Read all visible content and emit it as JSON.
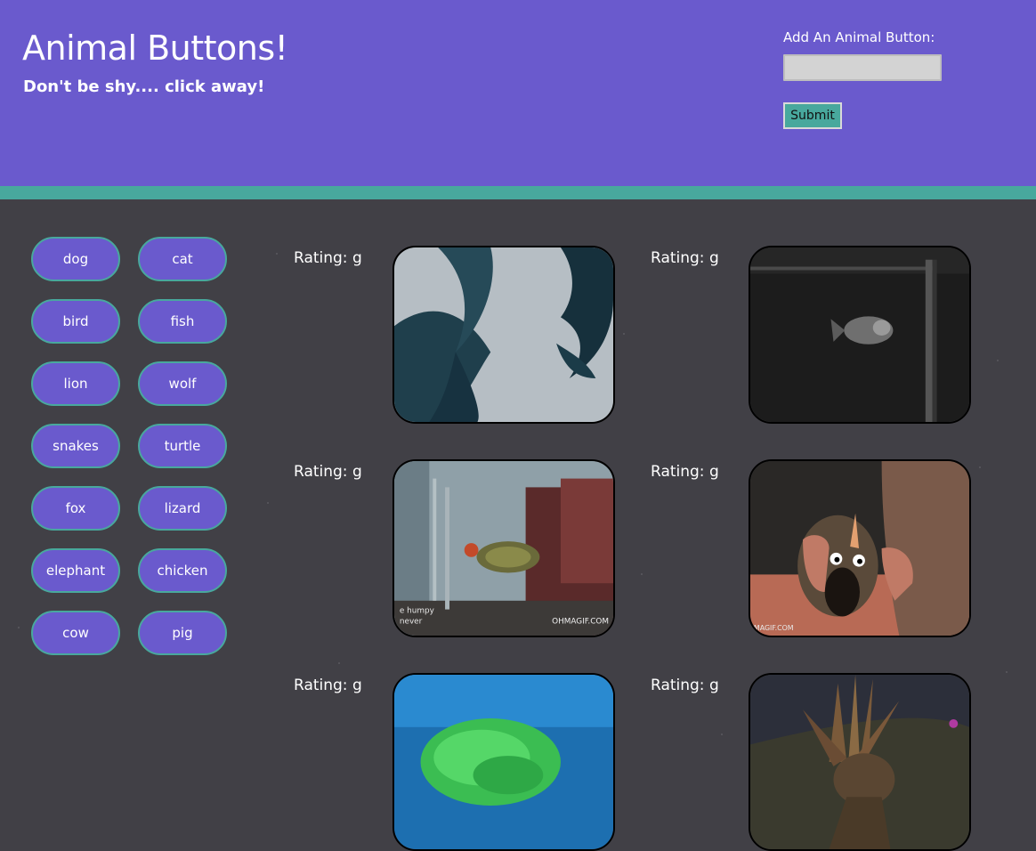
{
  "header": {
    "title": "Animal Buttons!",
    "subtitle": "Don't be shy.... click away!",
    "form_label": "Add An Animal Button:",
    "input_value": "",
    "submit_label": "Submit"
  },
  "animals": [
    "dog",
    "cat",
    "bird",
    "fish",
    "lion",
    "wolf",
    "snakes",
    "turtle",
    "fox",
    "lizard",
    "elephant",
    "chicken",
    "cow",
    "pig"
  ],
  "results": [
    {
      "rating": "Rating: g"
    },
    {
      "rating": "Rating: g"
    },
    {
      "rating": "Rating: g"
    },
    {
      "rating": "Rating: g"
    },
    {
      "rating": "Rating: g"
    },
    {
      "rating": "Rating: g"
    }
  ],
  "gif_watermarks": {
    "turtle_caption_1": "e humpy",
    "turtle_caption_2": "never",
    "turtle_logo": "OHMAGIF.COM",
    "toy_logo": "MAGIF.COM"
  },
  "colors": {
    "header_bg": "#6a5acd",
    "accent": "#48a89d",
    "page_bg": "#414046"
  }
}
